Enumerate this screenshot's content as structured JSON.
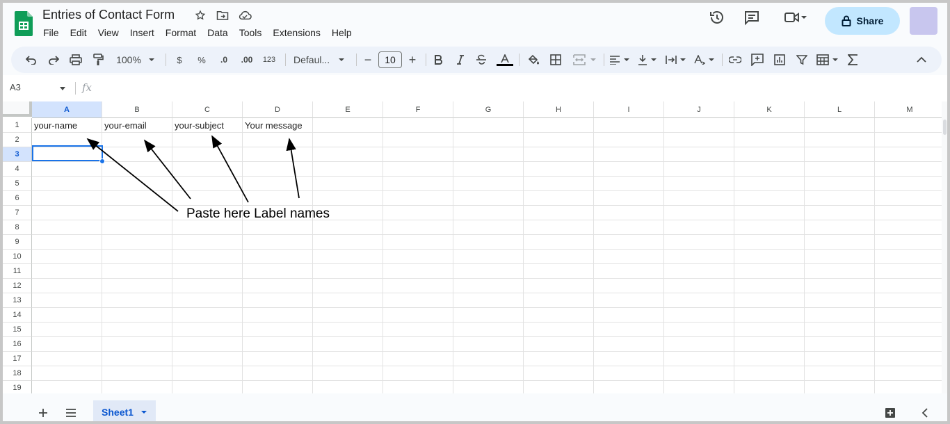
{
  "app": {
    "title": "Entries of Contact Form",
    "menu": [
      "File",
      "Edit",
      "View",
      "Insert",
      "Format",
      "Data",
      "Tools",
      "Extensions",
      "Help"
    ],
    "share_label": "Share"
  },
  "toolbar": {
    "zoom": "100%",
    "currency": "$",
    "percent": "%",
    "decrease_decimal": ".0",
    "increase_decimal": ".00",
    "number_format": "123",
    "font_name": "Defaul...",
    "font_size": "10",
    "minus": "−",
    "plus": "+"
  },
  "formula_bar": {
    "name_box": "A3",
    "fx": "fx"
  },
  "columns": [
    "A",
    "B",
    "C",
    "D",
    "E",
    "F",
    "G",
    "H",
    "I",
    "J",
    "K",
    "L",
    "M"
  ],
  "rows": [
    "1",
    "2",
    "3",
    "4",
    "5",
    "6",
    "7",
    "8",
    "9",
    "10",
    "11",
    "12",
    "13",
    "14",
    "15",
    "16",
    "17",
    "18",
    "19"
  ],
  "selected_cell": "A3",
  "cells": {
    "A1": "your-name",
    "B1": "your-email",
    "C1": "your-subject",
    "D1": "Your message"
  },
  "annotation": "Paste here Label names",
  "sheets": {
    "active": "Sheet1"
  },
  "colors": {
    "accent": "#1a73e8",
    "share_bg": "#c2e7ff",
    "logo": "#0f9d58"
  }
}
